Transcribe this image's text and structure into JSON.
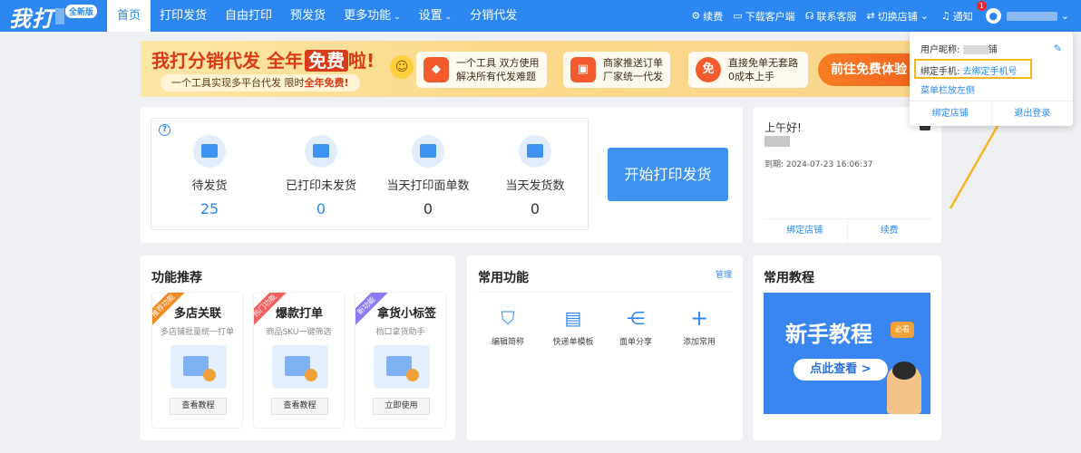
{
  "brand": {
    "logo": "我打",
    "badge": "全新版"
  },
  "nav": [
    {
      "label": "首页",
      "active": true
    },
    {
      "label": "打印发货"
    },
    {
      "label": "自由打印"
    },
    {
      "label": "预发货"
    },
    {
      "label": "更多功能",
      "caret": "⌄"
    },
    {
      "label": "设置",
      "caret": "⌄"
    },
    {
      "label": "分销代发"
    }
  ],
  "top_right": {
    "renew": "续费",
    "download": "下载客户端",
    "service": "联系客服",
    "switch_store": "切换店铺",
    "switch_caret": "⌄",
    "notice": "通知",
    "notice_count": "1",
    "user_caret": "⌄"
  },
  "banner": {
    "title_a": "我打分销代发 全年",
    "title_free": "免费",
    "title_b": "啦!",
    "sub_a": "一个工具实现多平台代发 限时",
    "sub_hl": "全年免费!",
    "cards": [
      {
        "icon": "◆",
        "line1": "一个工具 双方使用",
        "line2": "解决所有代发难题"
      },
      {
        "icon": "▣",
        "line1": "商家推送订单",
        "line2": "厂家统一代发"
      },
      {
        "icon": "免",
        "line1": "直接免单无套路",
        "line2": "0成本上手"
      }
    ],
    "cta": "前往免费体验"
  },
  "stats": {
    "help": "?",
    "items": [
      {
        "label": "待发货",
        "value": "25",
        "highlight": true
      },
      {
        "label": "已打印未发货",
        "value": "0",
        "highlight": true
      },
      {
        "label": "当天打印面单数",
        "value": "0",
        "highlight": false
      },
      {
        "label": "当天发货数",
        "value": "0",
        "highlight": false
      }
    ],
    "start_button": "开始打印发货"
  },
  "greeting": {
    "hello": "上午好!",
    "expire": "到期: 2024-07-23 16:06:37",
    "bind_store": "绑定店铺",
    "renew": "续费"
  },
  "recommend": {
    "title": "功能推荐",
    "cards": [
      {
        "ribbon": "推荐功能",
        "ribbon_color": "#f08a24",
        "name": "多店关联",
        "desc": "多店铺批量统一打单",
        "button": "查看教程"
      },
      {
        "ribbon": "热门功能",
        "ribbon_color": "#f25f5c",
        "name": "爆款打单",
        "desc": "商品SKU一键筛选",
        "button": "查看教程"
      },
      {
        "ribbon": "新功能",
        "ribbon_color": "#8a7cf0",
        "name": "拿货小标签",
        "desc": "档口拿货助手",
        "button": "立即使用"
      }
    ]
  },
  "functions": {
    "title": "常用功能",
    "manage": "管理",
    "items": [
      {
        "icon": "shopping-bag-icon",
        "glyph": "⛉",
        "label": "编辑简称"
      },
      {
        "icon": "template-icon",
        "glyph": "▤",
        "label": "快递单模板"
      },
      {
        "icon": "share-icon",
        "glyph": "⋲",
        "label": "面单分享"
      },
      {
        "icon": "plus-icon",
        "glyph": "+",
        "label": "添加常用"
      }
    ]
  },
  "tutorial": {
    "title": "常用教程",
    "image_title": "新手教程",
    "image_tag": "必看",
    "image_button": "点此查看 >"
  },
  "dropdown": {
    "nickname_label": "用户昵称:",
    "nickname_tail": "铺",
    "phone_label": "绑定手机:",
    "phone_link": "去绑定手机号",
    "menu_left": "菜单栏放左侧",
    "bind_store": "绑定店铺",
    "logout": "退出登录",
    "edit": "✎"
  },
  "colors": {
    "primary": "#2c88f0",
    "highlight_border": "#f6b51e",
    "banner_red": "#d83b16"
  }
}
